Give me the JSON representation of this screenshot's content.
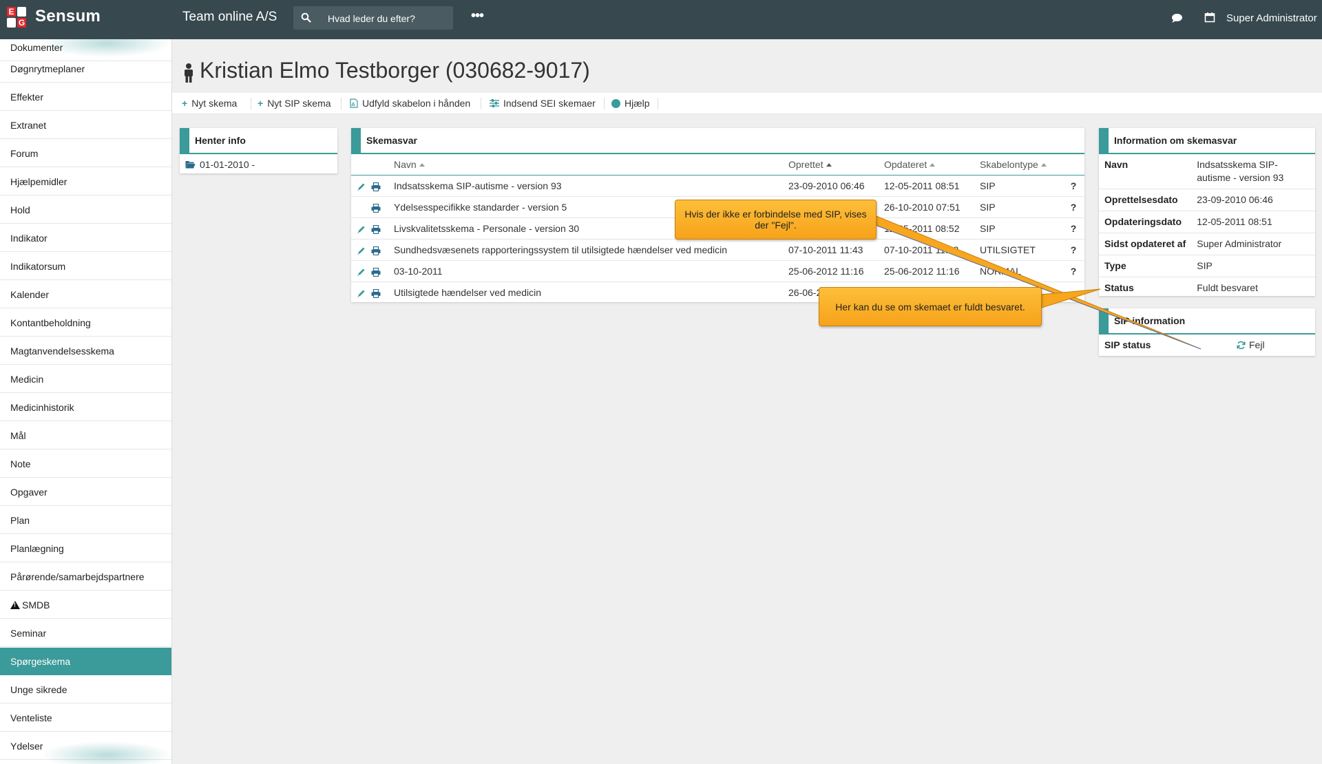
{
  "topbar": {
    "logo_letters": [
      "E",
      "G"
    ],
    "brand": "Sensum",
    "organization": "Team online A/S",
    "search_placeholder": "Hvad leder du efter?",
    "more_label": "•••",
    "user": "Super Administrator",
    "icons": [
      "search-icon",
      "chat-icon",
      "calendar-icon"
    ]
  },
  "sidebar": {
    "items": [
      {
        "label": "Dokumenter"
      },
      {
        "label": "Døgnrytmeplaner"
      },
      {
        "label": "Effekter"
      },
      {
        "label": "Extranet"
      },
      {
        "label": "Forum"
      },
      {
        "label": "Hjælpemidler"
      },
      {
        "label": "Hold"
      },
      {
        "label": "Indikator"
      },
      {
        "label": "Indikatorsum"
      },
      {
        "label": "Kalender"
      },
      {
        "label": "Kontantbeholdning"
      },
      {
        "label": "Magtanvendelsesskema"
      },
      {
        "label": "Medicin"
      },
      {
        "label": "Medicinhistorik"
      },
      {
        "label": "Mål"
      },
      {
        "label": "Note"
      },
      {
        "label": "Opgaver"
      },
      {
        "label": "Plan"
      },
      {
        "label": "Planlægning"
      },
      {
        "label": "Pårørende/samarbejdspartnere"
      },
      {
        "label": "SMDB",
        "icon": "warning-icon"
      },
      {
        "label": "Seminar"
      },
      {
        "label": "Spørgeskema",
        "active": true
      },
      {
        "label": "Unge sikrede"
      },
      {
        "label": "Venteliste"
      },
      {
        "label": "Ydelser"
      }
    ]
  },
  "page": {
    "title": "Kristian Elmo Testborger (030682-9017)"
  },
  "toolbar": {
    "new_form": "Nyt skema",
    "new_sip_form": "Nyt SIP skema",
    "fill_by_hand": "Udfyld skabelon i hånden",
    "submit_sei": "Indsend SEI skemaer",
    "help": "Hjælp"
  },
  "henter": {
    "title": "Henter info",
    "entry": "01-01-2010 -"
  },
  "skemasvar": {
    "title": "Skemasvar",
    "columns": [
      "Navn",
      "Oprettet",
      "Opdateret",
      "Skabelontype"
    ],
    "rows": [
      {
        "name": "Indsatsskema SIP-autisme - version 93",
        "created": "23-09-2010 06:46",
        "updated": "12-05-2011 08:51",
        "type": "SIP",
        "editable": true,
        "help": "?"
      },
      {
        "name": "Ydelsesspecifikke standarder - version 5",
        "created": "",
        "updated": "26-10-2010 07:51",
        "type": "SIP",
        "editable": false,
        "help": "?"
      },
      {
        "name": "Livskvalitetsskema - Personale - version 30",
        "created": "",
        "updated": "12-05-2011 08:52",
        "type": "SIP",
        "editable": true,
        "help": "?"
      },
      {
        "name": "Sundhedsvæsenets rapporteringssystem til utilsigtede hændelser ved medicin",
        "created": "07-10-2011 11:43",
        "updated": "07-10-2011 11:43",
        "type": "UTILSIGTET",
        "editable": true,
        "help": "?"
      },
      {
        "name": "03-10-2011",
        "created": "25-06-2012 11:16",
        "updated": "25-06-2012 11:16",
        "type": "NORMAL",
        "editable": true,
        "help": "?"
      },
      {
        "name": "Utilsigtede hændelser ved medicin",
        "created": "26-06-2012",
        "updated": "",
        "type": "",
        "editable": true,
        "help": ""
      }
    ]
  },
  "info": {
    "title": "Information om skemasvar",
    "rows": [
      {
        "key": "Navn",
        "value": "Indsatsskema SIP-autisme - version 93"
      },
      {
        "key": "Oprettelsesdato",
        "value": "23-09-2010 06:46"
      },
      {
        "key": "Opdateringsdato",
        "value": "12-05-2011 08:51"
      },
      {
        "key": "Sidst opdateret af",
        "value": "Super Administrator"
      },
      {
        "key": "Type",
        "value": "SIP"
      },
      {
        "key": "Status",
        "value": "Fuldt besvaret"
      }
    ]
  },
  "sip": {
    "title": "SIP information",
    "status_key": "SIP status",
    "status_value": "Fejl"
  },
  "callouts": {
    "sip_error": "Hvis der ikke er forbindelse med SIP, vises der \"Fejl\".",
    "status_hint": "Her kan du se om skemaet er fuldt besvaret."
  },
  "colors": {
    "topbar": "#37484f",
    "accent": "#3b9a9a",
    "callout": "#f9ad25"
  }
}
